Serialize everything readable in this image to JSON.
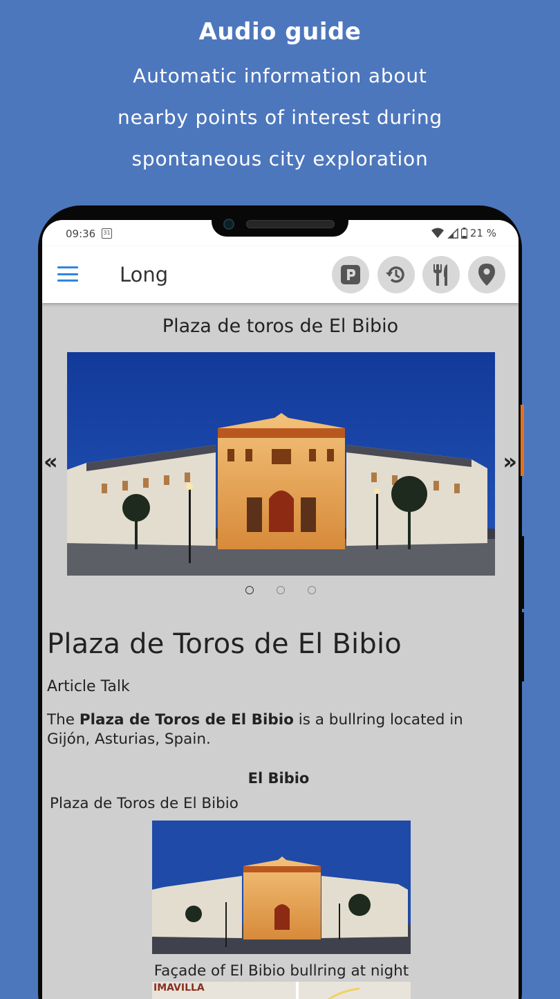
{
  "promo": {
    "title": "Audio guide",
    "line1": "Automatic information about",
    "line2": "nearby points of interest during",
    "line3": "spontaneous city exploration"
  },
  "status": {
    "time": "09:36",
    "calendar_day": "31",
    "battery": "21 %"
  },
  "appbar": {
    "title": "Long",
    "actions": [
      {
        "icon": "parking-icon"
      },
      {
        "icon": "history-icon"
      },
      {
        "icon": "restaurant-icon"
      },
      {
        "icon": "location-pin-icon"
      }
    ]
  },
  "carousel": {
    "title": "Plaza de toros de El Bibio",
    "prev": "«",
    "next": "»",
    "page_count": 3,
    "active_page": 1
  },
  "article": {
    "heading": "Plaza de Toros de El Bibio",
    "tabs": "Article Talk",
    "lead_prefix": "The ",
    "lead_bold": "Plaza de Toros de El Bibio",
    "lead_suffix": " is a bullring located in Gijón, Asturias, Spain.",
    "infobox_title": "El Bibio",
    "infobox_subtitle": "Plaza de Toros de El Bibio",
    "caption": "Façade of El Bibio bullring at night",
    "map_label": "IMAVILLA"
  },
  "colors": {
    "background": "#4d77bd",
    "accent": "#2e86de",
    "side_button": "#e6711c"
  }
}
